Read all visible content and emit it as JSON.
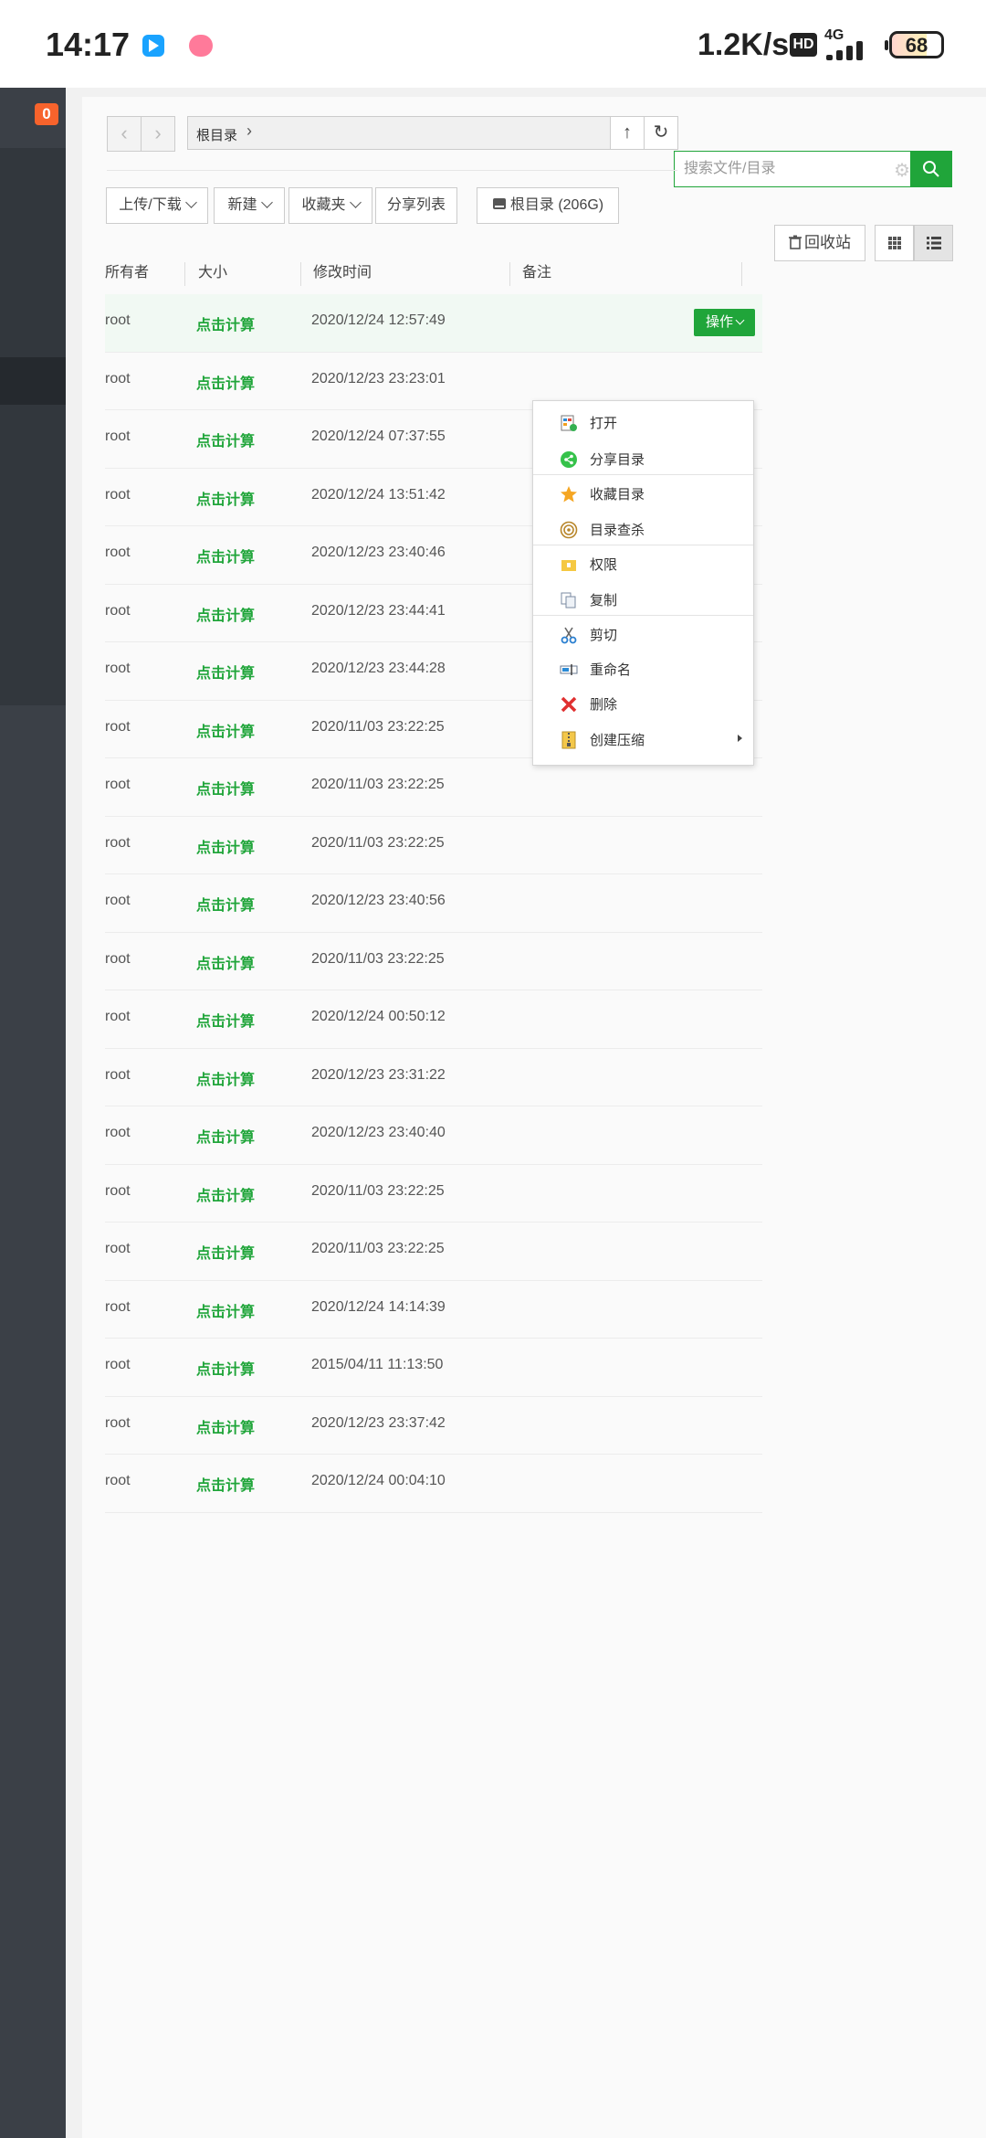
{
  "status_bar": {
    "time": "14:17",
    "net_speed": "1.2K/s",
    "hd": "HD",
    "network": "4G",
    "battery": "68"
  },
  "sidebar": {
    "badge": "0"
  },
  "toolbar": {
    "path_label": "根目录",
    "search_placeholder": "搜索文件/目录",
    "upload_download": "上传/下载",
    "new": "新建",
    "favorites": "收藏夹",
    "share_list": "分享列表",
    "root_disk": "根目录 (206G)",
    "recycle_bin": "回收站"
  },
  "table": {
    "headers": {
      "owner": "所有者",
      "size": "大小",
      "modified": "修改时间",
      "note": "备注"
    },
    "action_label": "操作",
    "rows": [
      {
        "owner": "root",
        "size": "点击计算",
        "time": "2020/12/24 12:57:49"
      },
      {
        "owner": "root",
        "size": "点击计算",
        "time": "2020/12/23 23:23:01"
      },
      {
        "owner": "root",
        "size": "点击计算",
        "time": "2020/12/24 07:37:55"
      },
      {
        "owner": "root",
        "size": "点击计算",
        "time": "2020/12/24 13:51:42"
      },
      {
        "owner": "root",
        "size": "点击计算",
        "time": "2020/12/23 23:40:46"
      },
      {
        "owner": "root",
        "size": "点击计算",
        "time": "2020/12/23 23:44:41"
      },
      {
        "owner": "root",
        "size": "点击计算",
        "time": "2020/12/23 23:44:28"
      },
      {
        "owner": "root",
        "size": "点击计算",
        "time": "2020/11/03 23:22:25"
      },
      {
        "owner": "root",
        "size": "点击计算",
        "time": "2020/11/03 23:22:25"
      },
      {
        "owner": "root",
        "size": "点击计算",
        "time": "2020/11/03 23:22:25"
      },
      {
        "owner": "root",
        "size": "点击计算",
        "time": "2020/12/23 23:40:56"
      },
      {
        "owner": "root",
        "size": "点击计算",
        "time": "2020/11/03 23:22:25"
      },
      {
        "owner": "root",
        "size": "点击计算",
        "time": "2020/12/24 00:50:12"
      },
      {
        "owner": "root",
        "size": "点击计算",
        "time": "2020/12/23 23:31:22"
      },
      {
        "owner": "root",
        "size": "点击计算",
        "time": "2020/12/23 23:40:40"
      },
      {
        "owner": "root",
        "size": "点击计算",
        "time": "2020/11/03 23:22:25"
      },
      {
        "owner": "root",
        "size": "点击计算",
        "time": "2020/11/03 23:22:25"
      },
      {
        "owner": "root",
        "size": "点击计算",
        "time": "2020/12/24 14:14:39"
      },
      {
        "owner": "root",
        "size": "点击计算",
        "time": "2015/04/11 11:13:50"
      },
      {
        "owner": "root",
        "size": "点击计算",
        "time": "2020/12/23 23:37:42"
      },
      {
        "owner": "root",
        "size": "点击计算",
        "time": "2020/12/24 00:04:10"
      }
    ]
  },
  "context_menu": {
    "items": [
      {
        "label": "打开",
        "icon": "open-icon"
      },
      {
        "label": "分享目录",
        "icon": "share-icon"
      },
      {
        "label": "收藏目录",
        "icon": "star-icon"
      },
      {
        "label": "目录查杀",
        "icon": "scan-icon"
      },
      {
        "label": "权限",
        "icon": "permission-icon"
      },
      {
        "label": "复制",
        "icon": "copy-icon"
      },
      {
        "label": "剪切",
        "icon": "cut-icon"
      },
      {
        "label": "重命名",
        "icon": "rename-icon"
      },
      {
        "label": "删除",
        "icon": "delete-icon"
      },
      {
        "label": "创建压缩",
        "icon": "compress-icon"
      }
    ]
  },
  "colors": {
    "accent": "#20a53a",
    "sidebar": "#3b4047",
    "badge": "#f7632c"
  }
}
